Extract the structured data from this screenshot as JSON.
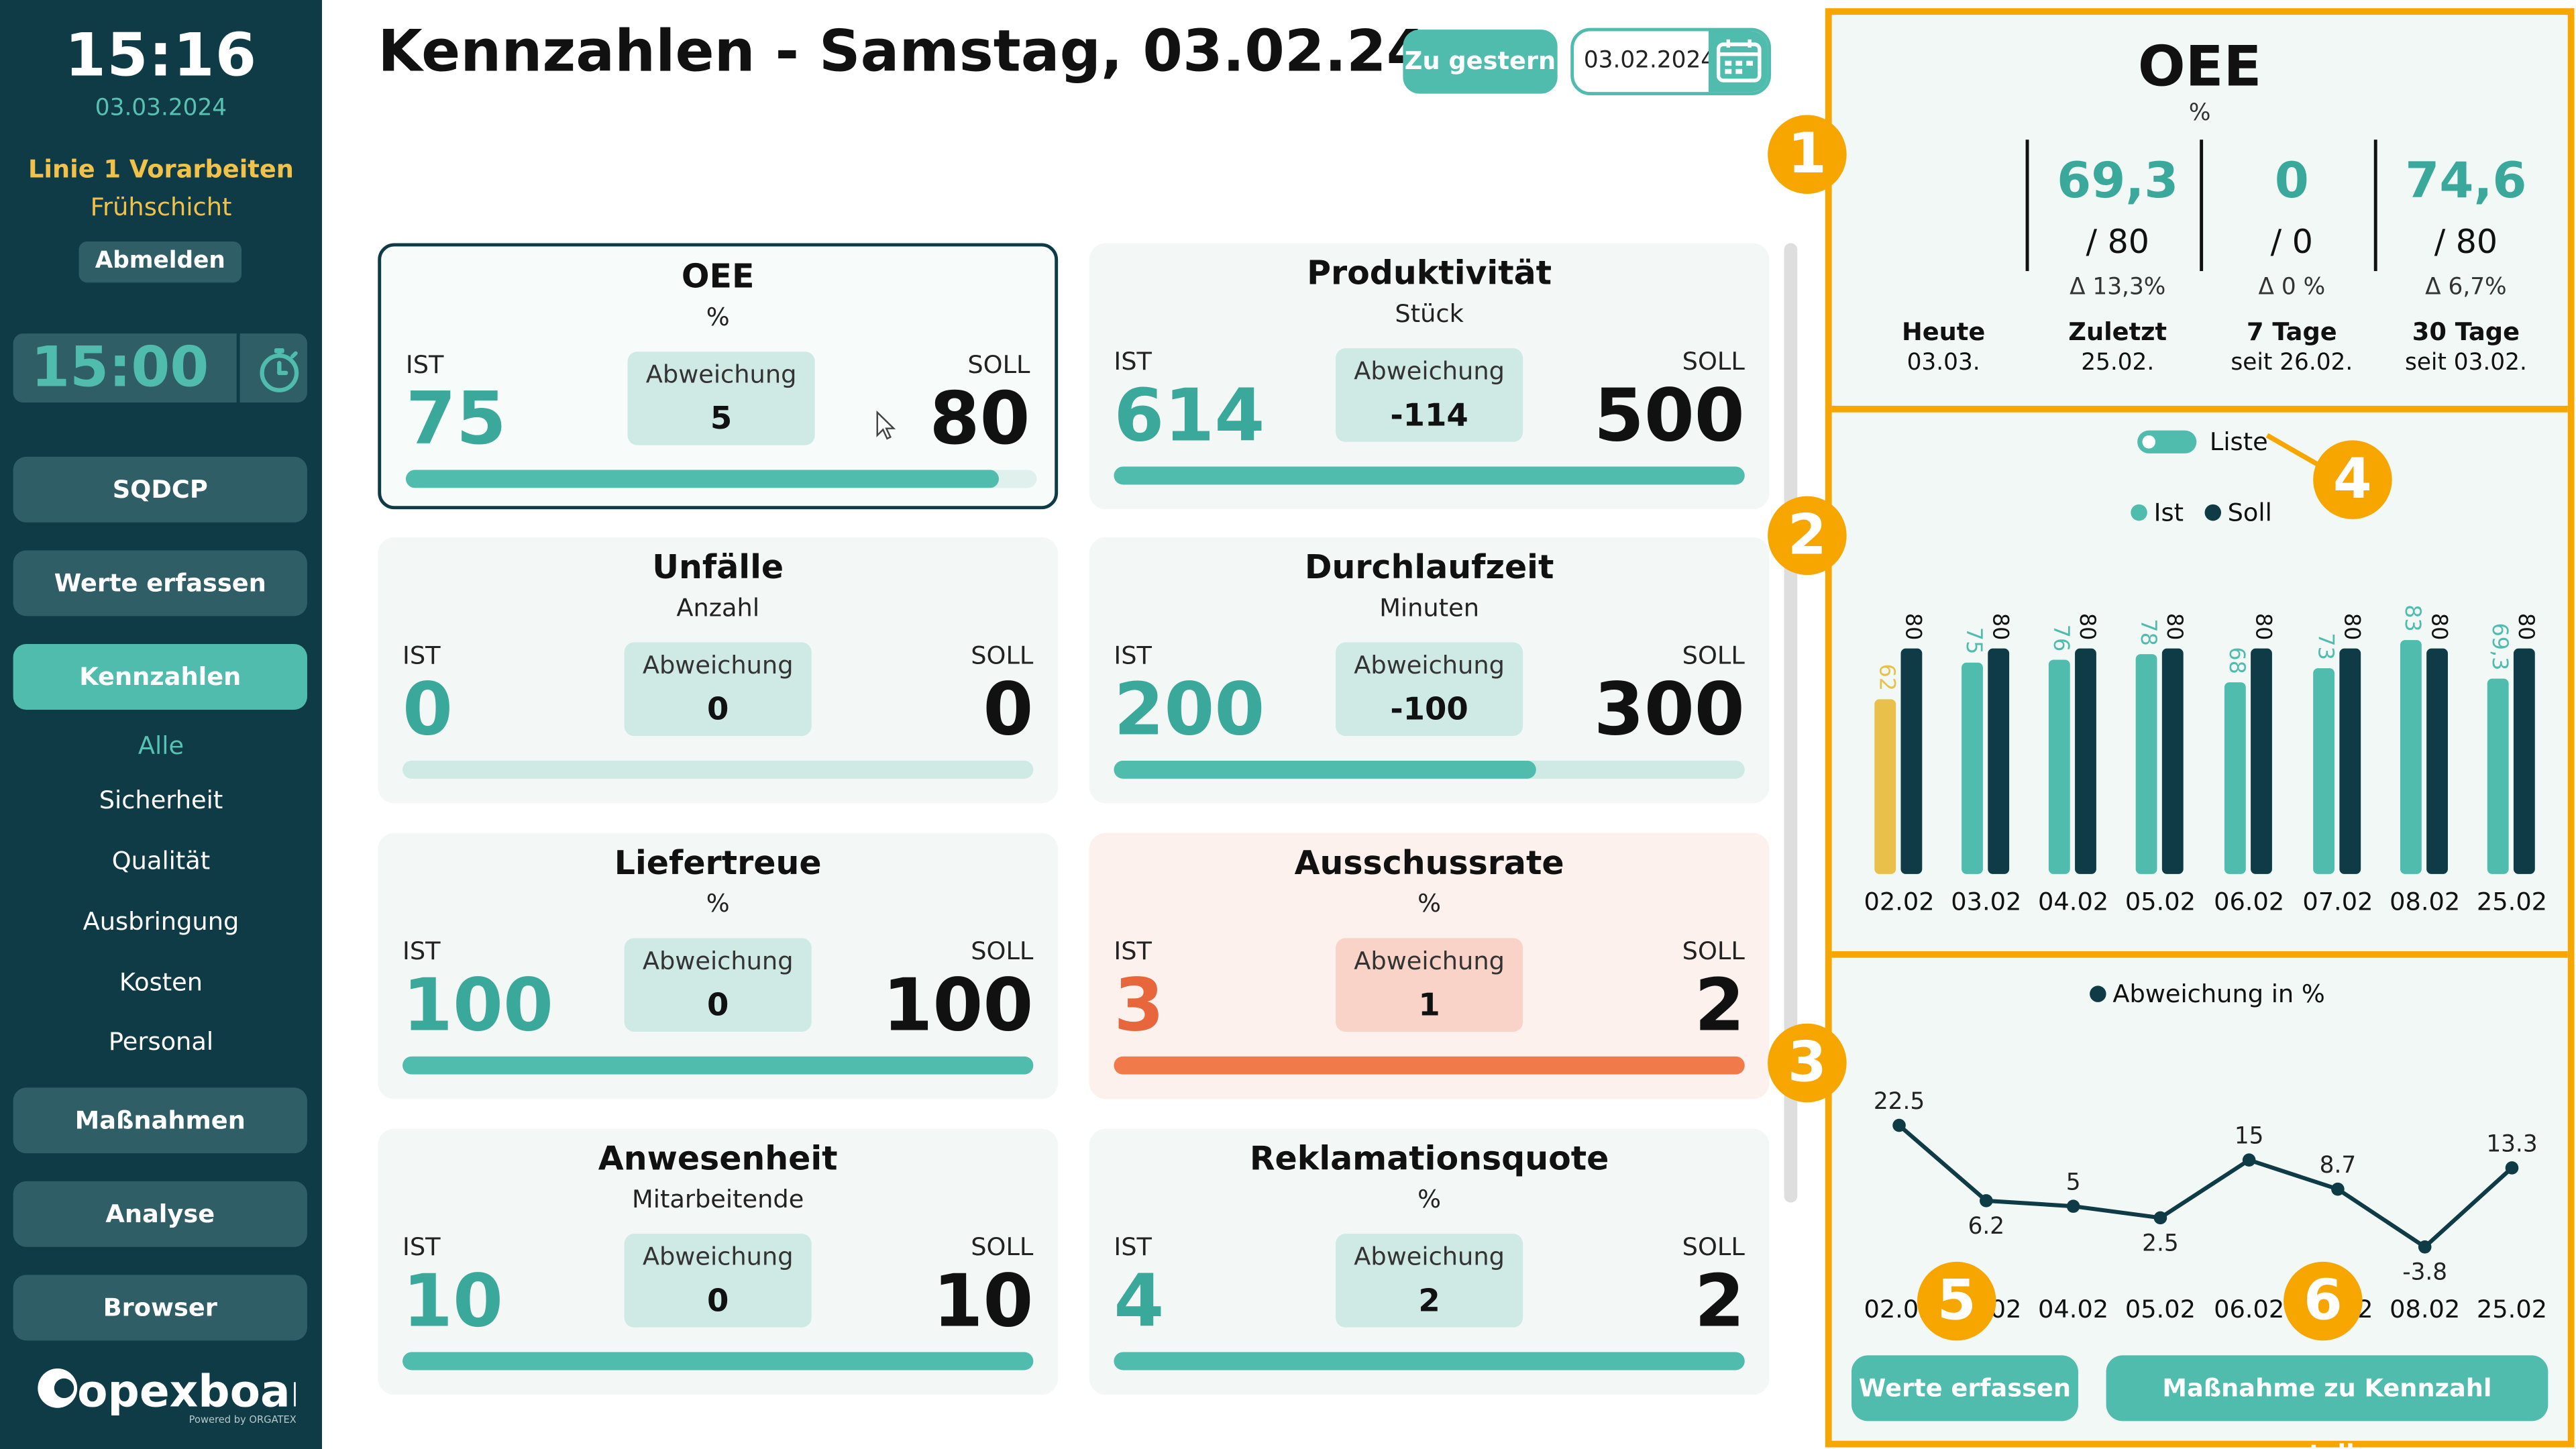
{
  "sidebar": {
    "time": "15:16",
    "date": "03.03.2024",
    "line": "Linie 1 Vorarbeiten",
    "shift": "Frühschicht",
    "logout_label": "Abmelden",
    "timer": "15:00",
    "timer_icon": "stopwatch-icon",
    "nav": [
      {
        "label": "SQDCP"
      },
      {
        "label": "Werte erfassen"
      },
      {
        "label": "Kennzahlen"
      },
      {
        "label": "Maßnahmen"
      },
      {
        "label": "Analyse"
      },
      {
        "label": "Browser"
      }
    ],
    "sub_nav": [
      {
        "label": "Alle"
      },
      {
        "label": "Sicherheit"
      },
      {
        "label": "Qualität"
      },
      {
        "label": "Ausbringung"
      },
      {
        "label": "Kosten"
      },
      {
        "label": "Personal"
      }
    ],
    "logo_text": "opexboard",
    "logo_sub": "Powered by ORGATEX"
  },
  "header": {
    "title": "Kennzahlen - Samstag, 03.02.24",
    "yesterday_label": "Zu gestern",
    "date_value": "03.02.2024",
    "calendar_icon": "calendar-icon"
  },
  "labels": {
    "ist": "IST",
    "soll": "SOLL",
    "deviation": "Abweichung"
  },
  "cards": [
    {
      "title": "OEE",
      "unit": "%",
      "ist": "75",
      "soll": "80",
      "deviation": "5",
      "progress": 0.94
    },
    {
      "title": "Produktivität",
      "unit": "Stück",
      "ist": "614",
      "soll": "500",
      "deviation": "-114",
      "progress": 1.0
    },
    {
      "title": "Unfälle",
      "unit": "Anzahl",
      "ist": "0",
      "soll": "0",
      "deviation": "0",
      "progress": 0
    },
    {
      "title": "Durchlaufzeit",
      "unit": "Minuten",
      "ist": "200",
      "soll": "300",
      "deviation": "-100",
      "progress": 0.67
    },
    {
      "title": "Liefertreue",
      "unit": "%",
      "ist": "100",
      "soll": "100",
      "deviation": "0",
      "progress": 1.0
    },
    {
      "title": "Ausschussrate",
      "unit": "%",
      "ist": "3",
      "soll": "2",
      "deviation": "1",
      "progress": 1.0
    },
    {
      "title": "Anwesenheit",
      "unit": "Mitarbeitende",
      "ist": "10",
      "soll": "10",
      "deviation": "0",
      "progress": 1.0
    },
    {
      "title": "Reklamationsquote",
      "unit": "%",
      "ist": "4",
      "soll": "2",
      "deviation": "2",
      "progress": 1.0
    }
  ],
  "oee_panel": {
    "title": "OEE",
    "unit": "%",
    "columns": [
      {
        "value": "69,3",
        "target": "/ 80",
        "delta": "Δ 13,3%"
      },
      {
        "value": "0",
        "target": "/ 0",
        "delta": "Δ 0 %"
      },
      {
        "value": "74,6",
        "target": "/ 80",
        "delta": "Δ 6,7%"
      }
    ],
    "periods": [
      {
        "name": "Heute",
        "sub": "03.03."
      },
      {
        "name": "Zuletzt",
        "sub": "25.02."
      },
      {
        "name": "7 Tage",
        "sub": "seit 26.02."
      },
      {
        "name": "30 Tage",
        "sub": "seit 03.02."
      }
    ]
  },
  "toggle_label": "Liste",
  "legend": {
    "ist": "Ist",
    "soll": "Soll",
    "deviation": "Abweichung in %"
  },
  "colors": {
    "accent": "#4fbcad",
    "dark": "#0e3b45",
    "warning": "#e8c04a",
    "alert": "#f07a4a",
    "highlight": "#f7a600"
  },
  "chart_data": [
    {
      "type": "bar",
      "categories": [
        "02.02",
        "03.02",
        "04.02",
        "05.02",
        "06.02",
        "07.02",
        "08.02",
        "25.02"
      ],
      "series": [
        {
          "name": "Ist",
          "values": [
            62,
            75,
            76,
            78,
            68,
            73,
            83,
            69.3
          ],
          "labels": [
            "62",
            "75",
            "76",
            "78",
            "68",
            "73",
            "83",
            "69,3"
          ]
        },
        {
          "name": "Soll",
          "values": [
            80,
            80,
            80,
            80,
            80,
            80,
            80,
            80
          ],
          "labels": [
            "80",
            "80",
            "80",
            "80",
            "80",
            "80",
            "80",
            "80"
          ]
        }
      ],
      "ylim": [
        0,
        88
      ]
    },
    {
      "type": "line",
      "categories": [
        "02.02",
        "03.02",
        "04.02",
        "05.02",
        "06.02",
        "07.02",
        "08.02",
        "25.02"
      ],
      "series": [
        {
          "name": "Abweichung in %",
          "values": [
            22.5,
            6.2,
            5,
            2.5,
            15,
            8.7,
            -3.8,
            13.3
          ]
        }
      ],
      "ylim": [
        -3.8,
        22.5
      ]
    }
  ],
  "actions": {
    "enter_values": "Werte erfassen",
    "create_measure": "Maßnahme zu Kennzahl erstellen"
  },
  "badges": [
    "1",
    "2",
    "3",
    "4",
    "5",
    "6"
  ]
}
